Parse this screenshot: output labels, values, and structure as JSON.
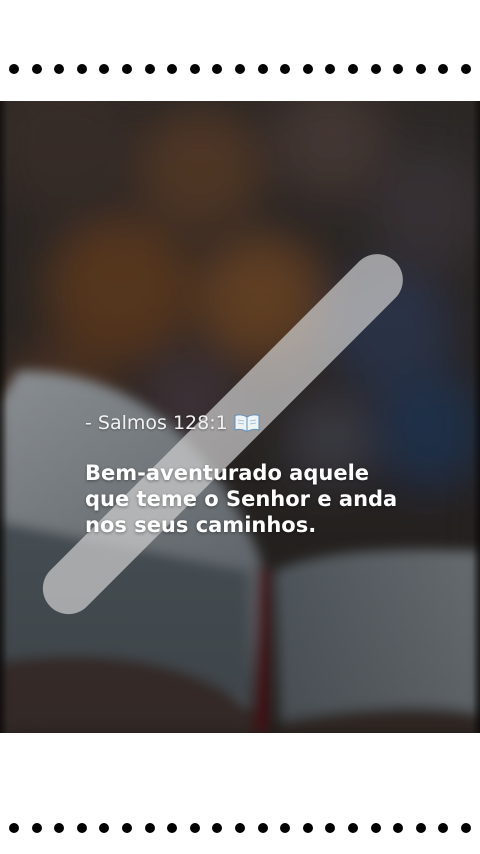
{
  "story": {
    "reference": "- Salmos 128:1",
    "reference_icon": "open-book-icon",
    "verse": "Bem-aventurado aquele que teme o Senhor e anda nos seus caminhos."
  },
  "decor": {
    "top_dots": 21,
    "bottom_dots": 21,
    "dot_color": "#000000",
    "frame_color": "#ffffff"
  },
  "colors": {
    "text": "#ffffff",
    "photo_bg": "#3a3430"
  }
}
